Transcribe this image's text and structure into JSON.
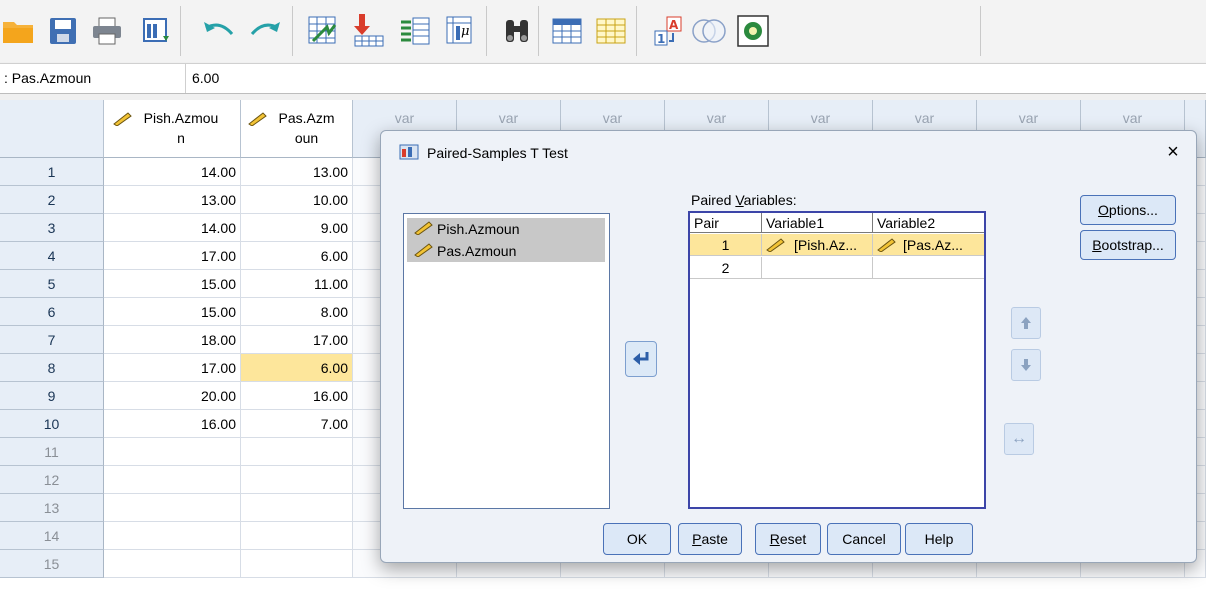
{
  "cell_editor": {
    "name": ": Pas.Azmoun",
    "value": "6.00"
  },
  "toolbar": {
    "icons": [
      "open-folder-icon",
      "save-icon",
      "print-icon",
      "dialog-recall-icon",
      "undo-icon",
      "redo-icon",
      "goto-case-icon",
      "goto-variable-icon",
      "variables-icon",
      "descriptive-stats-icon",
      "find-icon",
      "insert-cases-icon",
      "insert-variable-icon",
      "value-labels-icon",
      "sets-icon",
      "add-on-icon"
    ]
  },
  "grid": {
    "columns": [
      {
        "label": "Pish.Azmou\nn"
      },
      {
        "label": "Pas.Azm\noun"
      }
    ],
    "var_label": "var",
    "rows": [
      {
        "n": "1",
        "a": "14.00",
        "b": "13.00"
      },
      {
        "n": "2",
        "a": "13.00",
        "b": "10.00"
      },
      {
        "n": "3",
        "a": "14.00",
        "b": "9.00"
      },
      {
        "n": "4",
        "a": "17.00",
        "b": "6.00"
      },
      {
        "n": "5",
        "a": "15.00",
        "b": "11.00"
      },
      {
        "n": "6",
        "a": "15.00",
        "b": "8.00"
      },
      {
        "n": "7",
        "a": "18.00",
        "b": "17.00"
      },
      {
        "n": "8",
        "a": "17.00",
        "b": "6.00"
      },
      {
        "n": "9",
        "a": "20.00",
        "b": "16.00"
      },
      {
        "n": "10",
        "a": "16.00",
        "b": "7.00"
      },
      {
        "n": "11",
        "a": "",
        "b": ""
      },
      {
        "n": "12",
        "a": "",
        "b": ""
      },
      {
        "n": "13",
        "a": "",
        "b": ""
      },
      {
        "n": "14",
        "a": "",
        "b": ""
      },
      {
        "n": "15",
        "a": "",
        "b": ""
      }
    ]
  },
  "dialog": {
    "title": "Paired-Samples T Test",
    "close_glyph": "×",
    "source_vars": [
      "Pish.Azmoun",
      "Pas.Azmoun"
    ],
    "paired_label_pre": "Paired ",
    "paired_label_ul": "V",
    "paired_label_post": "ariables:",
    "headers": [
      "Pair",
      "Variable1",
      "Variable2"
    ],
    "pairs": [
      {
        "pair": "1",
        "var1": "[Pish.Az...",
        "var2": "[Pas.Az..."
      },
      {
        "pair": "2",
        "var1": "",
        "var2": ""
      }
    ],
    "options_ul": "O",
    "options_rest": "ptions...",
    "bootstrap_ul": "B",
    "bootstrap_rest": "ootstrap...",
    "ok": "OK",
    "paste_ul": "P",
    "paste_rest": "aste",
    "reset_ul": "R",
    "reset_rest": "eset",
    "cancel": "Cancel",
    "help": "Help",
    "swap_glyph": "↔"
  },
  "colors": {
    "selected_cell": "#fde69b",
    "header_bg": "#e7eef7",
    "dialog_bg": "#eef2f8",
    "accent": "#4a72b8"
  }
}
